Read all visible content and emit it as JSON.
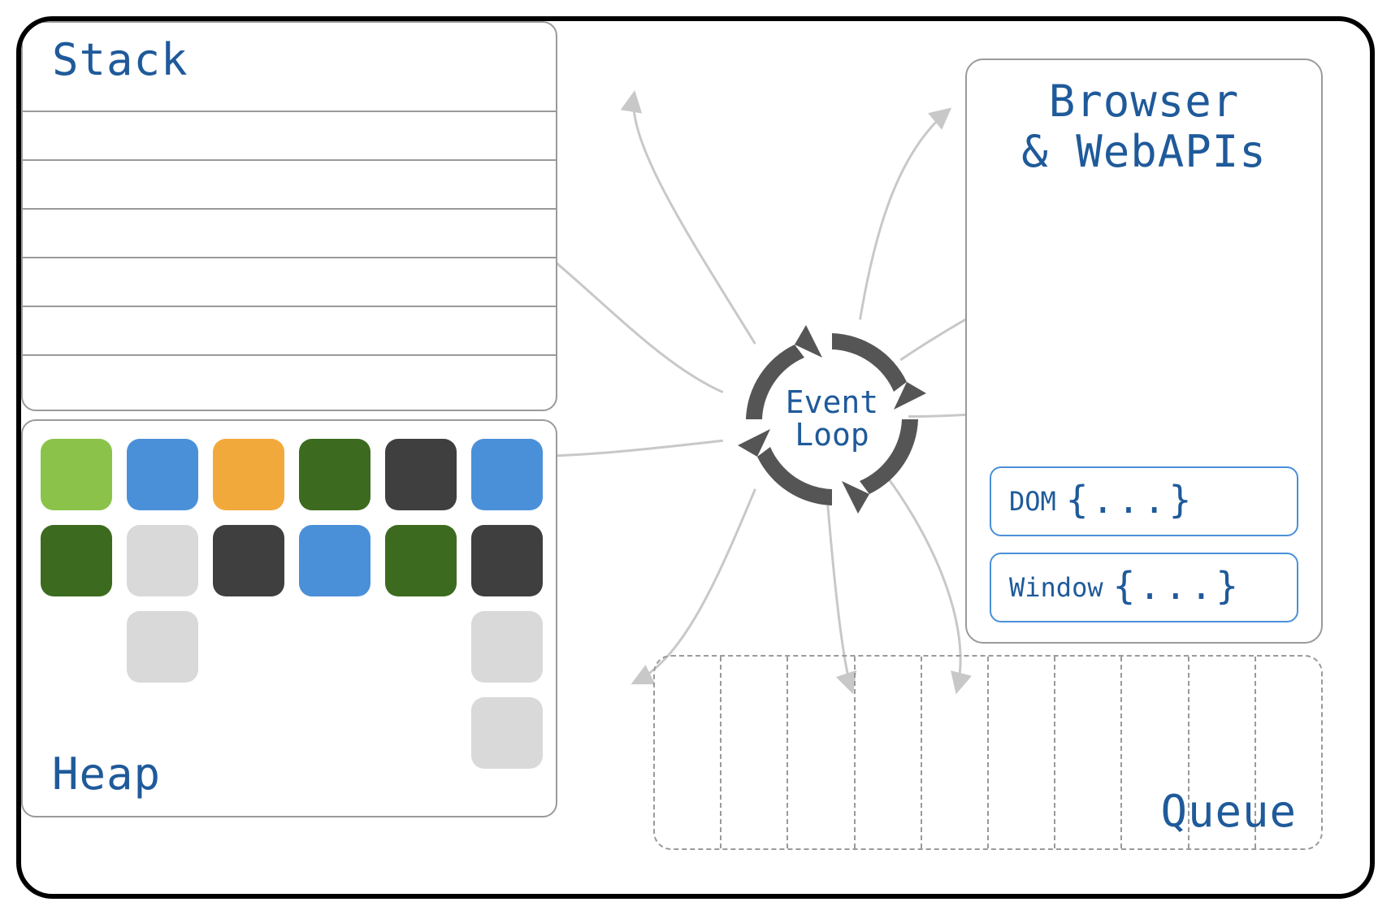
{
  "stack": {
    "title": "Stack",
    "rows": 6
  },
  "heap": {
    "title": "Heap",
    "grid": [
      [
        "lime",
        "blue",
        "orange",
        "dgreen",
        "dark",
        "blue"
      ],
      [
        "dgreen",
        "grey",
        "dark",
        "blue",
        "dgreen",
        "dark"
      ],
      [
        "",
        "grey",
        "",
        "",
        "",
        "grey"
      ],
      [
        "",
        "",
        "",
        "",
        "",
        "grey"
      ]
    ]
  },
  "eventLoop": {
    "line1": "Event",
    "line2": "Loop"
  },
  "browser": {
    "line1": "Browser",
    "line2": "& WebAPIs",
    "items": [
      {
        "label": "DOM",
        "braces": "{...}"
      },
      {
        "label": "Window",
        "braces": "{...}"
      }
    ]
  },
  "queue": {
    "title": "Queue",
    "slots": 10
  },
  "colors": {
    "text": "#1f5a9a",
    "border": "#9a9a9a",
    "arrow": "#cfcfcf",
    "loopArrow": "#555555",
    "lime": "#8bc34a",
    "blue": "#4a90d9",
    "orange": "#f2a93b",
    "dgreen": "#3c6b1f",
    "dark": "#3f3f3f",
    "grey": "#d9d9d9"
  }
}
